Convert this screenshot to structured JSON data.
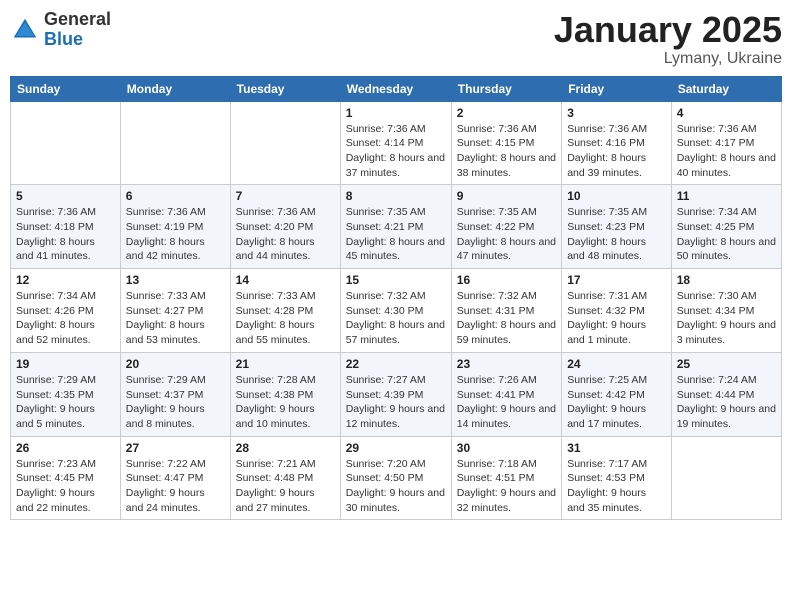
{
  "logo": {
    "general": "General",
    "blue": "Blue"
  },
  "title": {
    "month": "January 2025",
    "location": "Lymany, Ukraine"
  },
  "weekdays": [
    "Sunday",
    "Monday",
    "Tuesday",
    "Wednesday",
    "Thursday",
    "Friday",
    "Saturday"
  ],
  "weeks": [
    [
      {
        "day": "",
        "info": ""
      },
      {
        "day": "",
        "info": ""
      },
      {
        "day": "",
        "info": ""
      },
      {
        "day": "1",
        "info": "Sunrise: 7:36 AM\nSunset: 4:14 PM\nDaylight: 8 hours and 37 minutes."
      },
      {
        "day": "2",
        "info": "Sunrise: 7:36 AM\nSunset: 4:15 PM\nDaylight: 8 hours and 38 minutes."
      },
      {
        "day": "3",
        "info": "Sunrise: 7:36 AM\nSunset: 4:16 PM\nDaylight: 8 hours and 39 minutes."
      },
      {
        "day": "4",
        "info": "Sunrise: 7:36 AM\nSunset: 4:17 PM\nDaylight: 8 hours and 40 minutes."
      }
    ],
    [
      {
        "day": "5",
        "info": "Sunrise: 7:36 AM\nSunset: 4:18 PM\nDaylight: 8 hours and 41 minutes."
      },
      {
        "day": "6",
        "info": "Sunrise: 7:36 AM\nSunset: 4:19 PM\nDaylight: 8 hours and 42 minutes."
      },
      {
        "day": "7",
        "info": "Sunrise: 7:36 AM\nSunset: 4:20 PM\nDaylight: 8 hours and 44 minutes."
      },
      {
        "day": "8",
        "info": "Sunrise: 7:35 AM\nSunset: 4:21 PM\nDaylight: 8 hours and 45 minutes."
      },
      {
        "day": "9",
        "info": "Sunrise: 7:35 AM\nSunset: 4:22 PM\nDaylight: 8 hours and 47 minutes."
      },
      {
        "day": "10",
        "info": "Sunrise: 7:35 AM\nSunset: 4:23 PM\nDaylight: 8 hours and 48 minutes."
      },
      {
        "day": "11",
        "info": "Sunrise: 7:34 AM\nSunset: 4:25 PM\nDaylight: 8 hours and 50 minutes."
      }
    ],
    [
      {
        "day": "12",
        "info": "Sunrise: 7:34 AM\nSunset: 4:26 PM\nDaylight: 8 hours and 52 minutes."
      },
      {
        "day": "13",
        "info": "Sunrise: 7:33 AM\nSunset: 4:27 PM\nDaylight: 8 hours and 53 minutes."
      },
      {
        "day": "14",
        "info": "Sunrise: 7:33 AM\nSunset: 4:28 PM\nDaylight: 8 hours and 55 minutes."
      },
      {
        "day": "15",
        "info": "Sunrise: 7:32 AM\nSunset: 4:30 PM\nDaylight: 8 hours and 57 minutes."
      },
      {
        "day": "16",
        "info": "Sunrise: 7:32 AM\nSunset: 4:31 PM\nDaylight: 8 hours and 59 minutes."
      },
      {
        "day": "17",
        "info": "Sunrise: 7:31 AM\nSunset: 4:32 PM\nDaylight: 9 hours and 1 minute."
      },
      {
        "day": "18",
        "info": "Sunrise: 7:30 AM\nSunset: 4:34 PM\nDaylight: 9 hours and 3 minutes."
      }
    ],
    [
      {
        "day": "19",
        "info": "Sunrise: 7:29 AM\nSunset: 4:35 PM\nDaylight: 9 hours and 5 minutes."
      },
      {
        "day": "20",
        "info": "Sunrise: 7:29 AM\nSunset: 4:37 PM\nDaylight: 9 hours and 8 minutes."
      },
      {
        "day": "21",
        "info": "Sunrise: 7:28 AM\nSunset: 4:38 PM\nDaylight: 9 hours and 10 minutes."
      },
      {
        "day": "22",
        "info": "Sunrise: 7:27 AM\nSunset: 4:39 PM\nDaylight: 9 hours and 12 minutes."
      },
      {
        "day": "23",
        "info": "Sunrise: 7:26 AM\nSunset: 4:41 PM\nDaylight: 9 hours and 14 minutes."
      },
      {
        "day": "24",
        "info": "Sunrise: 7:25 AM\nSunset: 4:42 PM\nDaylight: 9 hours and 17 minutes."
      },
      {
        "day": "25",
        "info": "Sunrise: 7:24 AM\nSunset: 4:44 PM\nDaylight: 9 hours and 19 minutes."
      }
    ],
    [
      {
        "day": "26",
        "info": "Sunrise: 7:23 AM\nSunset: 4:45 PM\nDaylight: 9 hours and 22 minutes."
      },
      {
        "day": "27",
        "info": "Sunrise: 7:22 AM\nSunset: 4:47 PM\nDaylight: 9 hours and 24 minutes."
      },
      {
        "day": "28",
        "info": "Sunrise: 7:21 AM\nSunset: 4:48 PM\nDaylight: 9 hours and 27 minutes."
      },
      {
        "day": "29",
        "info": "Sunrise: 7:20 AM\nSunset: 4:50 PM\nDaylight: 9 hours and 30 minutes."
      },
      {
        "day": "30",
        "info": "Sunrise: 7:18 AM\nSunset: 4:51 PM\nDaylight: 9 hours and 32 minutes."
      },
      {
        "day": "31",
        "info": "Sunrise: 7:17 AM\nSunset: 4:53 PM\nDaylight: 9 hours and 35 minutes."
      },
      {
        "day": "",
        "info": ""
      }
    ]
  ]
}
